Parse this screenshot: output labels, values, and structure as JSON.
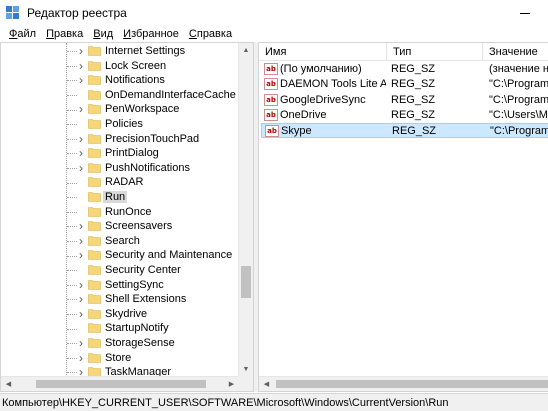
{
  "window": {
    "title": "Редактор реестра"
  },
  "menu": {
    "items": [
      {
        "label": "Файл",
        "accel": "Ф",
        "rest": "айл"
      },
      {
        "label": "Правка",
        "accel": "П",
        "rest": "равка"
      },
      {
        "label": "Вид",
        "accel": "В",
        "rest": "ид"
      },
      {
        "label": "Избранное",
        "accel": "И",
        "rest": "збранное"
      },
      {
        "label": "Справка",
        "accel": "С",
        "rest": "правка"
      }
    ]
  },
  "tree": {
    "items": [
      {
        "label": "Internet Settings",
        "expandable": true
      },
      {
        "label": "Lock Screen",
        "expandable": true
      },
      {
        "label": "Notifications",
        "expandable": true
      },
      {
        "label": "OnDemandInterfaceCache",
        "expandable": false
      },
      {
        "label": "PenWorkspace",
        "expandable": true
      },
      {
        "label": "Policies",
        "expandable": false
      },
      {
        "label": "PrecisionTouchPad",
        "expandable": true
      },
      {
        "label": "PrintDialog",
        "expandable": true
      },
      {
        "label": "PushNotifications",
        "expandable": true
      },
      {
        "label": "RADAR",
        "expandable": false
      },
      {
        "label": "Run",
        "expandable": false,
        "selected": true
      },
      {
        "label": "RunOnce",
        "expandable": false
      },
      {
        "label": "Screensavers",
        "expandable": true
      },
      {
        "label": "Search",
        "expandable": true
      },
      {
        "label": "Security and Maintenance",
        "expandable": true
      },
      {
        "label": "Security Center",
        "expandable": false
      },
      {
        "label": "SettingSync",
        "expandable": true
      },
      {
        "label": "Shell Extensions",
        "expandable": true
      },
      {
        "label": "Skydrive",
        "expandable": true
      },
      {
        "label": "StartupNotify",
        "expandable": false
      },
      {
        "label": "StorageSense",
        "expandable": true
      },
      {
        "label": "Store",
        "expandable": true
      },
      {
        "label": "TaskManager",
        "expandable": true
      }
    ]
  },
  "values": {
    "columns": {
      "name": "Имя",
      "type": "Тип",
      "data": "Значение"
    },
    "rows": [
      {
        "name": "(По умолчанию)",
        "type": "REG_SZ",
        "data": "(значение не"
      },
      {
        "name": "DAEMON Tools Lite Au...",
        "type": "REG_SZ",
        "data": "\"C:\\Program F"
      },
      {
        "name": "GoogleDriveSync",
        "type": "REG_SZ",
        "data": "\"C:\\Program F"
      },
      {
        "name": "OneDrive",
        "type": "REG_SZ",
        "data": "\"C:\\Users\\M M"
      },
      {
        "name": "Skype",
        "type": "REG_SZ",
        "data": "\"C:\\Program F",
        "selected": true
      }
    ],
    "icon_text": "ab"
  },
  "status": {
    "path": "Компьютер\\HKEY_CURRENT_USER\\SOFTWARE\\Microsoft\\Windows\\CurrentVersion\\Run"
  },
  "colors": {
    "selection": "#cce8ff",
    "folder": "#f5d77a"
  }
}
